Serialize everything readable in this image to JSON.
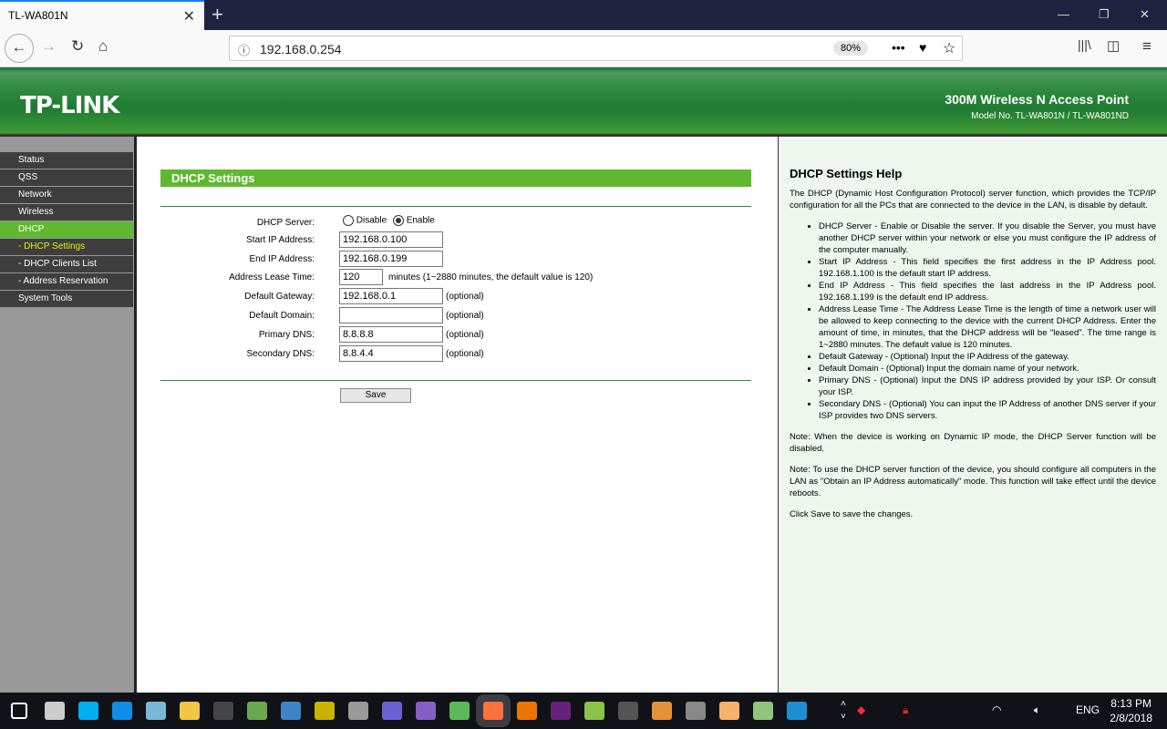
{
  "browser": {
    "tab_title": "TL-WA801N",
    "url": "192.168.0.254",
    "zoom": "80%"
  },
  "header": {
    "logo": "TP-LINK",
    "product": "300M Wireless N Access Point",
    "model": "Model No. TL-WA801N / TL-WA801ND"
  },
  "sidebar": {
    "items": [
      {
        "label": "Status",
        "state": "normal"
      },
      {
        "label": "QSS",
        "state": "normal"
      },
      {
        "label": "Network",
        "state": "normal"
      },
      {
        "label": "Wireless",
        "state": "normal"
      },
      {
        "label": "DHCP",
        "state": "active"
      },
      {
        "label": "- DHCP Settings",
        "state": "current"
      },
      {
        "label": "- DHCP Clients List",
        "state": "sub"
      },
      {
        "label": "- Address Reservation",
        "state": "sub"
      },
      {
        "label": "System Tools",
        "state": "normal"
      }
    ]
  },
  "form": {
    "title": "DHCP Settings",
    "server_label": "DHCP Server:",
    "disable": "Disable",
    "enable": "Enable",
    "server_value": "Enable",
    "start_label": "Start IP Address:",
    "start": "192.168.0.100",
    "end_label": "End IP Address:",
    "end": "192.168.0.199",
    "lease_label": "Address Lease Time:",
    "lease": "120",
    "lease_note": "minutes (1~2880 minutes, the default value is 120)",
    "gw_label": "Default Gateway:",
    "gw": "192.168.0.1",
    "domain_label": "Default Domain:",
    "domain": "",
    "dns1_label": "Primary DNS:",
    "dns1": "8.8.8.8",
    "dns2_label": "Secondary DNS:",
    "dns2": "8.8.4.4",
    "optional": "(optional)",
    "save": "Save"
  },
  "help": {
    "title": "DHCP Settings Help",
    "intro": "The DHCP (Dynamic Host Configuration Protocol) server function, which provides the TCP/IP configuration for all the PCs that are connected to the device in the LAN, is disable by default.",
    "items": [
      "DHCP Server - Enable or Disable the server. If you disable the Server, you must have another DHCP server within your network or else you must configure the IP address of the computer manually.",
      "Start IP Address - This field specifies the first address in the IP Address pool. 192.168.1.100 is the default start IP address.",
      "End IP Address - This field specifies the last address in the IP Address pool. 192.168.1.199 is the default end IP address.",
      "Address Lease Time - The Address Lease Time is the length of time a network user will be allowed to keep connecting to the device with the current DHCP Address. Enter the amount of time, in minutes, that the DHCP address will be \"leased\". The time range is 1~2880 minutes. The default value is 120 minutes.",
      "Default Gateway - (Optional) Input the IP Address of the gateway.",
      "Default Domain - (Optional) Input the domain name of your network.",
      "Primary DNS - (Optional) Input the DNS IP address provided by your ISP. Or consult your ISP.",
      "Secondary DNS - (Optional) You can input the IP Address of another DNS server if your ISP provides two DNS servers."
    ],
    "note1": "Note: When the device is working on Dynamic IP mode, the DHCP Server function will be disabled.",
    "note2": "Note: To use the DHCP server function of the device, you should configure all computers in the LAN as \"Obtain an IP Address automatically\" mode. This function will take effect until the device reboots.",
    "outro": "Click Save to save the changes."
  },
  "taskbar": {
    "lang": "ENG",
    "time": "8:13 PM",
    "date": "2/8/2018",
    "apps": [
      {
        "name": "windows-start",
        "color": "#ffffff"
      },
      {
        "name": "task-view",
        "color": "#cccccc"
      },
      {
        "name": "skype",
        "color": "#00aff0"
      },
      {
        "name": "teamviewer",
        "color": "#0e8ee9"
      },
      {
        "name": "notes",
        "color": "#7ab8d8"
      },
      {
        "name": "file-explorer",
        "color": "#f3c543"
      },
      {
        "name": "terminal",
        "color": "#444444"
      },
      {
        "name": "app-paint",
        "color": "#6aa84f"
      },
      {
        "name": "network-tool",
        "color": "#3d85c6"
      },
      {
        "name": "app-yellow",
        "color": "#c9b200"
      },
      {
        "name": "tools",
        "color": "#999999"
      },
      {
        "name": "infinity",
        "color": "#6d5fd5"
      },
      {
        "name": "visual-studio",
        "color": "#865fc5"
      },
      {
        "name": "globe",
        "color": "#5cb85c"
      },
      {
        "name": "firefox",
        "color": "#ff7139"
      },
      {
        "name": "blender",
        "color": "#ea7600"
      },
      {
        "name": "visual-studio-alt",
        "color": "#68217a"
      },
      {
        "name": "app-green",
        "color": "#8bc34a"
      },
      {
        "name": "app-r",
        "color": "#555555"
      },
      {
        "name": "app-sun",
        "color": "#e69138"
      },
      {
        "name": "video-editor",
        "color": "#888888"
      },
      {
        "name": "app-orange",
        "color": "#f6b26b"
      },
      {
        "name": "spreadsheet",
        "color": "#93c47d"
      },
      {
        "name": "app-blue",
        "color": "#1f8dd6"
      }
    ]
  }
}
